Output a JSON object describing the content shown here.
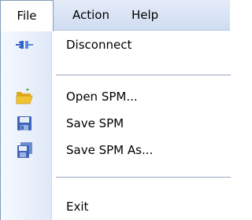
{
  "menubar": {
    "file_label": "File",
    "action_label": "Action",
    "help_label": "Help"
  },
  "file_menu": {
    "items": [
      {
        "label": "Disconnect",
        "icon": "disconnect-plug-icon"
      },
      {
        "label": "Open SPM...",
        "icon": "folder-open-icon"
      },
      {
        "label": "Save SPM",
        "icon": "floppy-disk-icon"
      },
      {
        "label": "Save SPM As...",
        "icon": "save-as-icon"
      },
      {
        "label": "Exit"
      }
    ]
  },
  "colors": {
    "menubar_bg": "#d6e1f3",
    "accent_blue": "#2e63c9",
    "folder_yellow": "#f1c232",
    "separator": "#9aa7c0"
  }
}
